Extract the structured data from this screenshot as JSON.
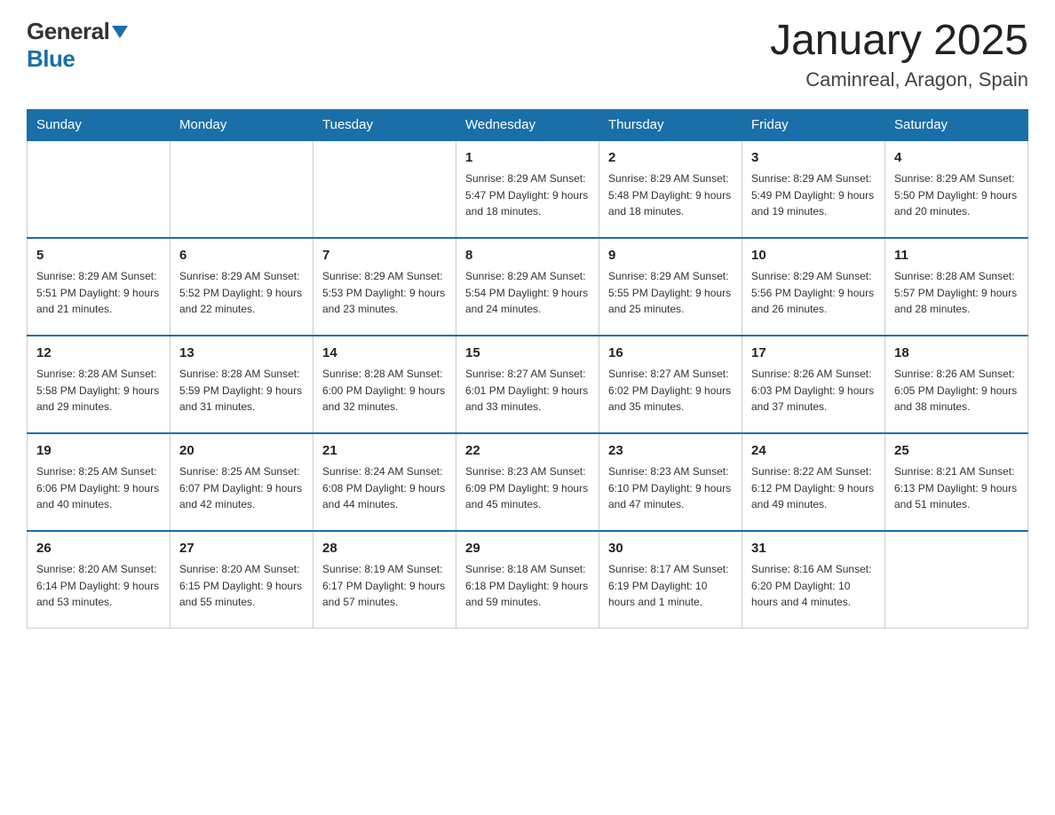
{
  "header": {
    "title": "January 2025",
    "subtitle": "Caminreal, Aragon, Spain",
    "logo_general": "General",
    "logo_blue": "Blue"
  },
  "columns": [
    "Sunday",
    "Monday",
    "Tuesday",
    "Wednesday",
    "Thursday",
    "Friday",
    "Saturday"
  ],
  "weeks": [
    [
      {
        "day": "",
        "info": ""
      },
      {
        "day": "",
        "info": ""
      },
      {
        "day": "",
        "info": ""
      },
      {
        "day": "1",
        "info": "Sunrise: 8:29 AM\nSunset: 5:47 PM\nDaylight: 9 hours\nand 18 minutes."
      },
      {
        "day": "2",
        "info": "Sunrise: 8:29 AM\nSunset: 5:48 PM\nDaylight: 9 hours\nand 18 minutes."
      },
      {
        "day": "3",
        "info": "Sunrise: 8:29 AM\nSunset: 5:49 PM\nDaylight: 9 hours\nand 19 minutes."
      },
      {
        "day": "4",
        "info": "Sunrise: 8:29 AM\nSunset: 5:50 PM\nDaylight: 9 hours\nand 20 minutes."
      }
    ],
    [
      {
        "day": "5",
        "info": "Sunrise: 8:29 AM\nSunset: 5:51 PM\nDaylight: 9 hours\nand 21 minutes."
      },
      {
        "day": "6",
        "info": "Sunrise: 8:29 AM\nSunset: 5:52 PM\nDaylight: 9 hours\nand 22 minutes."
      },
      {
        "day": "7",
        "info": "Sunrise: 8:29 AM\nSunset: 5:53 PM\nDaylight: 9 hours\nand 23 minutes."
      },
      {
        "day": "8",
        "info": "Sunrise: 8:29 AM\nSunset: 5:54 PM\nDaylight: 9 hours\nand 24 minutes."
      },
      {
        "day": "9",
        "info": "Sunrise: 8:29 AM\nSunset: 5:55 PM\nDaylight: 9 hours\nand 25 minutes."
      },
      {
        "day": "10",
        "info": "Sunrise: 8:29 AM\nSunset: 5:56 PM\nDaylight: 9 hours\nand 26 minutes."
      },
      {
        "day": "11",
        "info": "Sunrise: 8:28 AM\nSunset: 5:57 PM\nDaylight: 9 hours\nand 28 minutes."
      }
    ],
    [
      {
        "day": "12",
        "info": "Sunrise: 8:28 AM\nSunset: 5:58 PM\nDaylight: 9 hours\nand 29 minutes."
      },
      {
        "day": "13",
        "info": "Sunrise: 8:28 AM\nSunset: 5:59 PM\nDaylight: 9 hours\nand 31 minutes."
      },
      {
        "day": "14",
        "info": "Sunrise: 8:28 AM\nSunset: 6:00 PM\nDaylight: 9 hours\nand 32 minutes."
      },
      {
        "day": "15",
        "info": "Sunrise: 8:27 AM\nSunset: 6:01 PM\nDaylight: 9 hours\nand 33 minutes."
      },
      {
        "day": "16",
        "info": "Sunrise: 8:27 AM\nSunset: 6:02 PM\nDaylight: 9 hours\nand 35 minutes."
      },
      {
        "day": "17",
        "info": "Sunrise: 8:26 AM\nSunset: 6:03 PM\nDaylight: 9 hours\nand 37 minutes."
      },
      {
        "day": "18",
        "info": "Sunrise: 8:26 AM\nSunset: 6:05 PM\nDaylight: 9 hours\nand 38 minutes."
      }
    ],
    [
      {
        "day": "19",
        "info": "Sunrise: 8:25 AM\nSunset: 6:06 PM\nDaylight: 9 hours\nand 40 minutes."
      },
      {
        "day": "20",
        "info": "Sunrise: 8:25 AM\nSunset: 6:07 PM\nDaylight: 9 hours\nand 42 minutes."
      },
      {
        "day": "21",
        "info": "Sunrise: 8:24 AM\nSunset: 6:08 PM\nDaylight: 9 hours\nand 44 minutes."
      },
      {
        "day": "22",
        "info": "Sunrise: 8:23 AM\nSunset: 6:09 PM\nDaylight: 9 hours\nand 45 minutes."
      },
      {
        "day": "23",
        "info": "Sunrise: 8:23 AM\nSunset: 6:10 PM\nDaylight: 9 hours\nand 47 minutes."
      },
      {
        "day": "24",
        "info": "Sunrise: 8:22 AM\nSunset: 6:12 PM\nDaylight: 9 hours\nand 49 minutes."
      },
      {
        "day": "25",
        "info": "Sunrise: 8:21 AM\nSunset: 6:13 PM\nDaylight: 9 hours\nand 51 minutes."
      }
    ],
    [
      {
        "day": "26",
        "info": "Sunrise: 8:20 AM\nSunset: 6:14 PM\nDaylight: 9 hours\nand 53 minutes."
      },
      {
        "day": "27",
        "info": "Sunrise: 8:20 AM\nSunset: 6:15 PM\nDaylight: 9 hours\nand 55 minutes."
      },
      {
        "day": "28",
        "info": "Sunrise: 8:19 AM\nSunset: 6:17 PM\nDaylight: 9 hours\nand 57 minutes."
      },
      {
        "day": "29",
        "info": "Sunrise: 8:18 AM\nSunset: 6:18 PM\nDaylight: 9 hours\nand 59 minutes."
      },
      {
        "day": "30",
        "info": "Sunrise: 8:17 AM\nSunset: 6:19 PM\nDaylight: 10 hours\nand 1 minute."
      },
      {
        "day": "31",
        "info": "Sunrise: 8:16 AM\nSunset: 6:20 PM\nDaylight: 10 hours\nand 4 minutes."
      },
      {
        "day": "",
        "info": ""
      }
    ]
  ],
  "colors": {
    "header_bg": "#1a6fa8",
    "header_text": "#ffffff",
    "border_top": "#1a6fa8",
    "cell_border": "#cccccc"
  }
}
